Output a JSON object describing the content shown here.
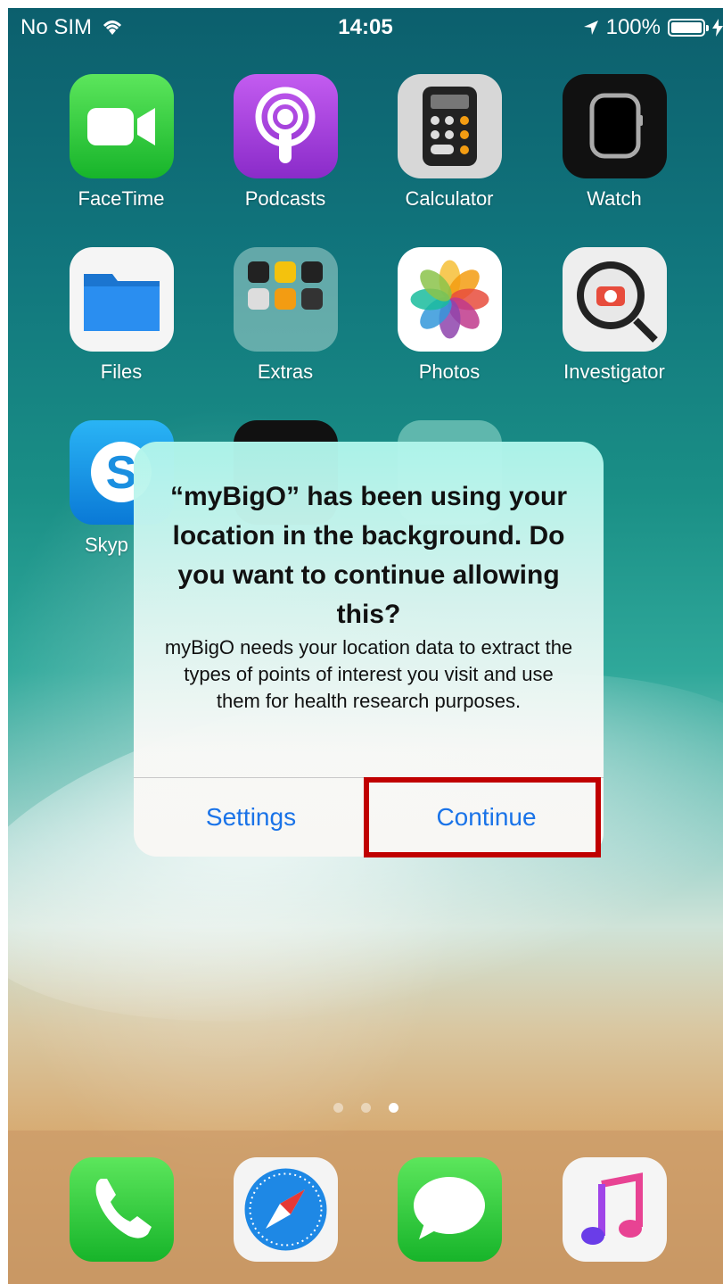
{
  "status_bar": {
    "carrier": "No SIM",
    "time": "14:05",
    "battery": "100%"
  },
  "home_apps": [
    {
      "label": "FaceTime"
    },
    {
      "label": "Podcasts"
    },
    {
      "label": "Calculator"
    },
    {
      "label": "Watch"
    },
    {
      "label": "Files"
    },
    {
      "label": "Extras"
    },
    {
      "label": "Photos"
    },
    {
      "label": "Investigator"
    },
    {
      "label": "Skyp"
    }
  ],
  "page_dots": {
    "count": 3,
    "active": 3
  },
  "dock_apps": [
    "phone-icon",
    "safari-icon",
    "messages-icon",
    "music-icon"
  ],
  "alert": {
    "title": "“myBigO” has been using your location in the background. Do you want to continue allowing this?",
    "message": "myBigO needs your location data to extract the types of points of interest you visit and use them for health research purposes.",
    "settings_label": "Settings",
    "continue_label": "Continue"
  },
  "colors": {
    "button_text": "#1a73e8",
    "highlight": "#c00000"
  }
}
